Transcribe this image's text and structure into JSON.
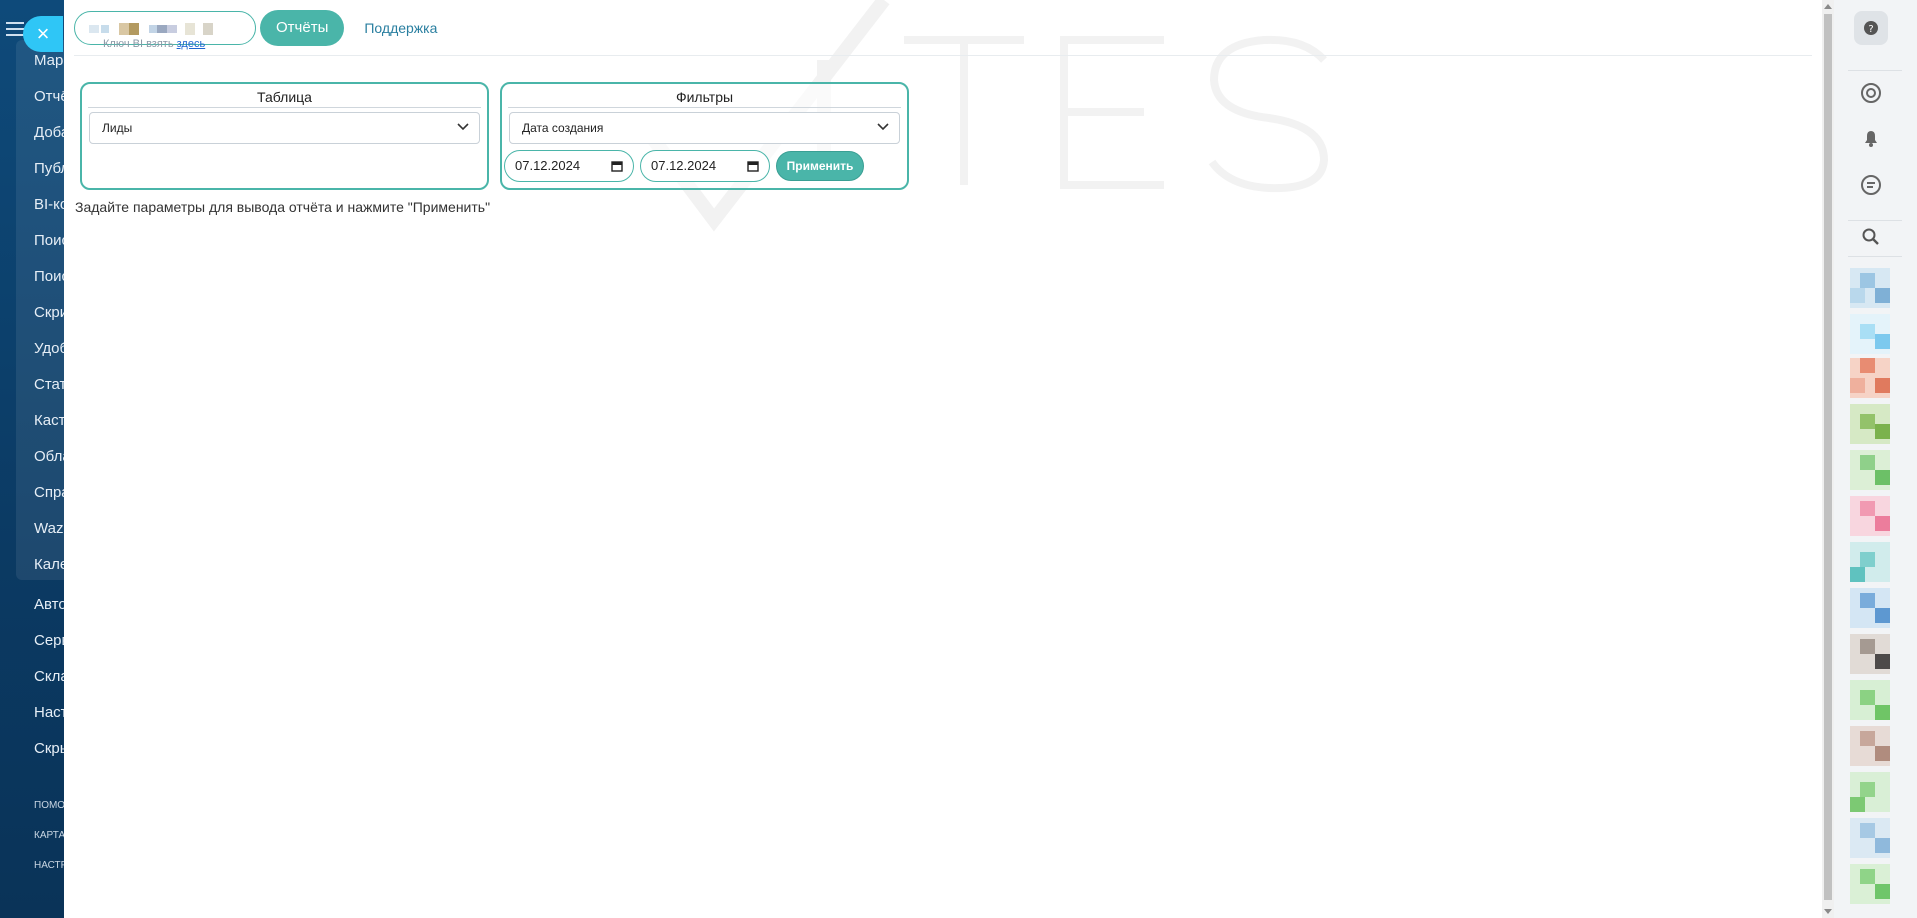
{
  "sidebar": {
    "items": [
      "Мар",
      "Отчё",
      "Доба",
      "Публ",
      "BI-ко",
      "Поис",
      "Поис",
      "Скри",
      "Удоб",
      "Стат",
      "Каст",
      "Обла",
      "Спра",
      "Wazz",
      "Кале",
      "Авто",
      "Серв",
      "Скла",
      "Наст",
      "Скры"
    ],
    "footer_items": [
      "помо",
      "карта",
      "настр"
    ]
  },
  "close_label": "×",
  "topbar": {
    "tab_reports": "Отчёты",
    "tab_support": "Поддержка",
    "key_hint": "Ключ BI взять",
    "key_link": "здесь"
  },
  "table_card": {
    "title": "Таблица",
    "selected": "Лиды"
  },
  "filters_card": {
    "title": "Фильтры",
    "selected": "Дата создания",
    "date_from": "07.12.2024",
    "date_to": "07.12.2024",
    "apply_label": "Применить"
  },
  "hint_text": "Задайте параметры для вывода отчёта и нажмите \"Применить\"",
  "colors": {
    "accent": "#4ab5a9",
    "close_button": "#2fc6f6",
    "sidebar": "#0b3a63"
  },
  "icons": {
    "help": "question-icon",
    "copilot": "copilot-icon",
    "notifications": "bell-icon",
    "chat": "chat-icon",
    "search": "search-icon"
  }
}
